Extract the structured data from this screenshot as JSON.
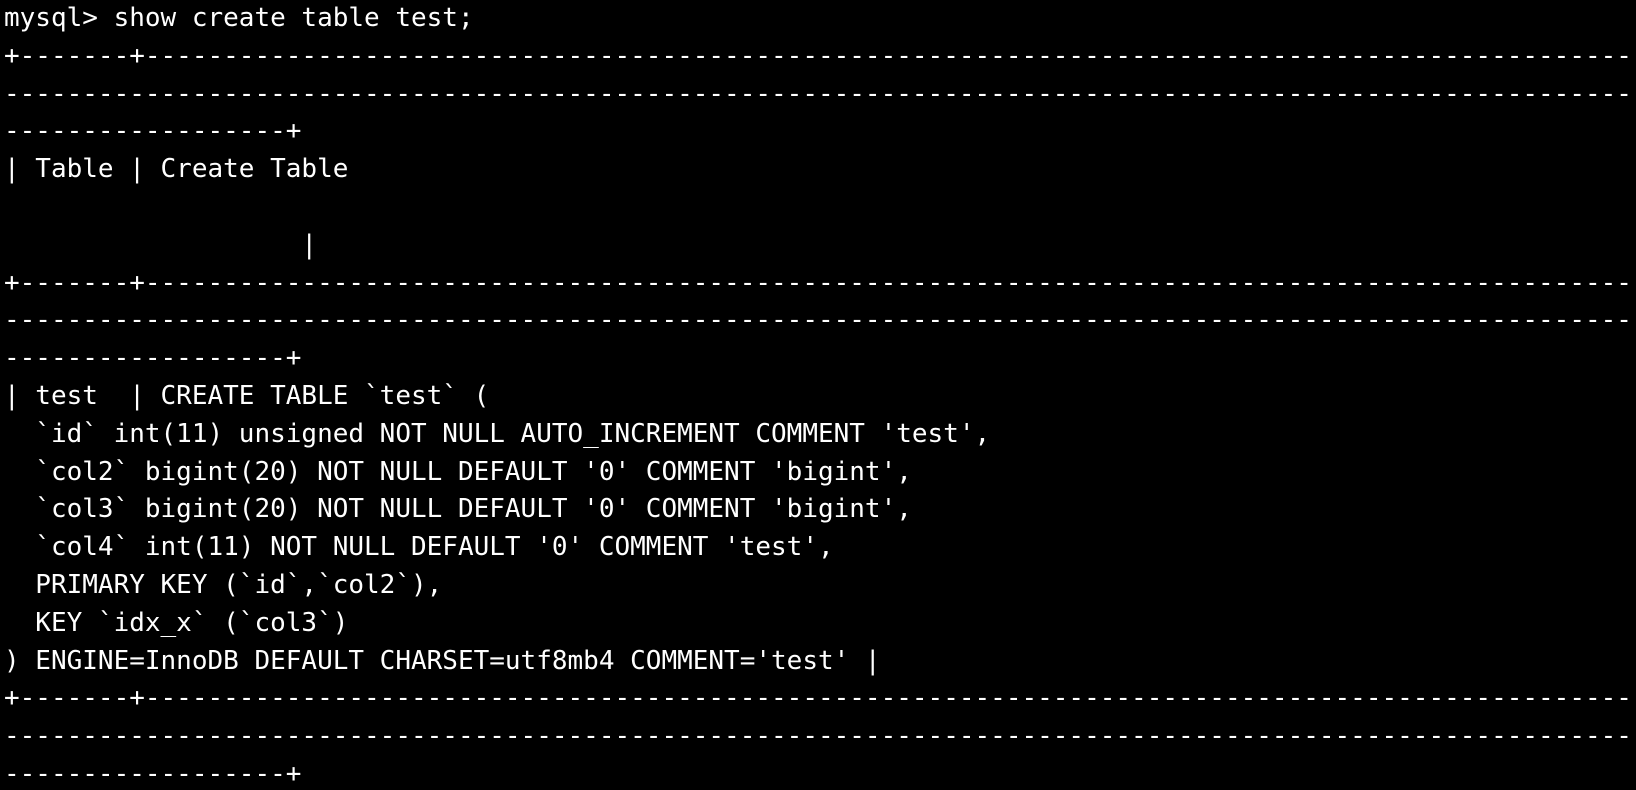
{
  "terminal": {
    "colors": {
      "background": "#000000",
      "foreground": "#ffffff"
    },
    "prompt": "mysql> ",
    "command": "show create table test;",
    "lines": [
      "+-------+--------------------------------------------------------------------------------------------------------------------------------------------------------------------",
      "------------------------------------------------------------------------------------------------------------------------------------------------------------------------------",
      "------------------+",
      "| Table | Create Table",
      "",
      "                   |",
      "+-------+--------------------------------------------------------------------------------------------------------------------------------------------------------------------",
      "------------------------------------------------------------------------------------------------------------------------------------------------------------------------------",
      "------------------+",
      "| test  | CREATE TABLE `test` (",
      "  `id` int(11) unsigned NOT NULL AUTO_INCREMENT COMMENT 'test',",
      "  `col2` bigint(20) NOT NULL DEFAULT '0' COMMENT 'bigint',",
      "  `col3` bigint(20) NOT NULL DEFAULT '0' COMMENT 'bigint',",
      "  `col4` int(11) NOT NULL DEFAULT '0' COMMENT 'test',",
      "  PRIMARY KEY (`id`,`col2`),",
      "  KEY `idx_x` (`col3`)",
      ") ENGINE=InnoDB DEFAULT CHARSET=utf8mb4 COMMENT='test' |",
      "+-------+--------------------------------------------------------------------------------------------------------------------------------------------------------------------",
      "------------------------------------------------------------------------------------------------------------------------------------------------------------------------------",
      "------------------+"
    ]
  }
}
